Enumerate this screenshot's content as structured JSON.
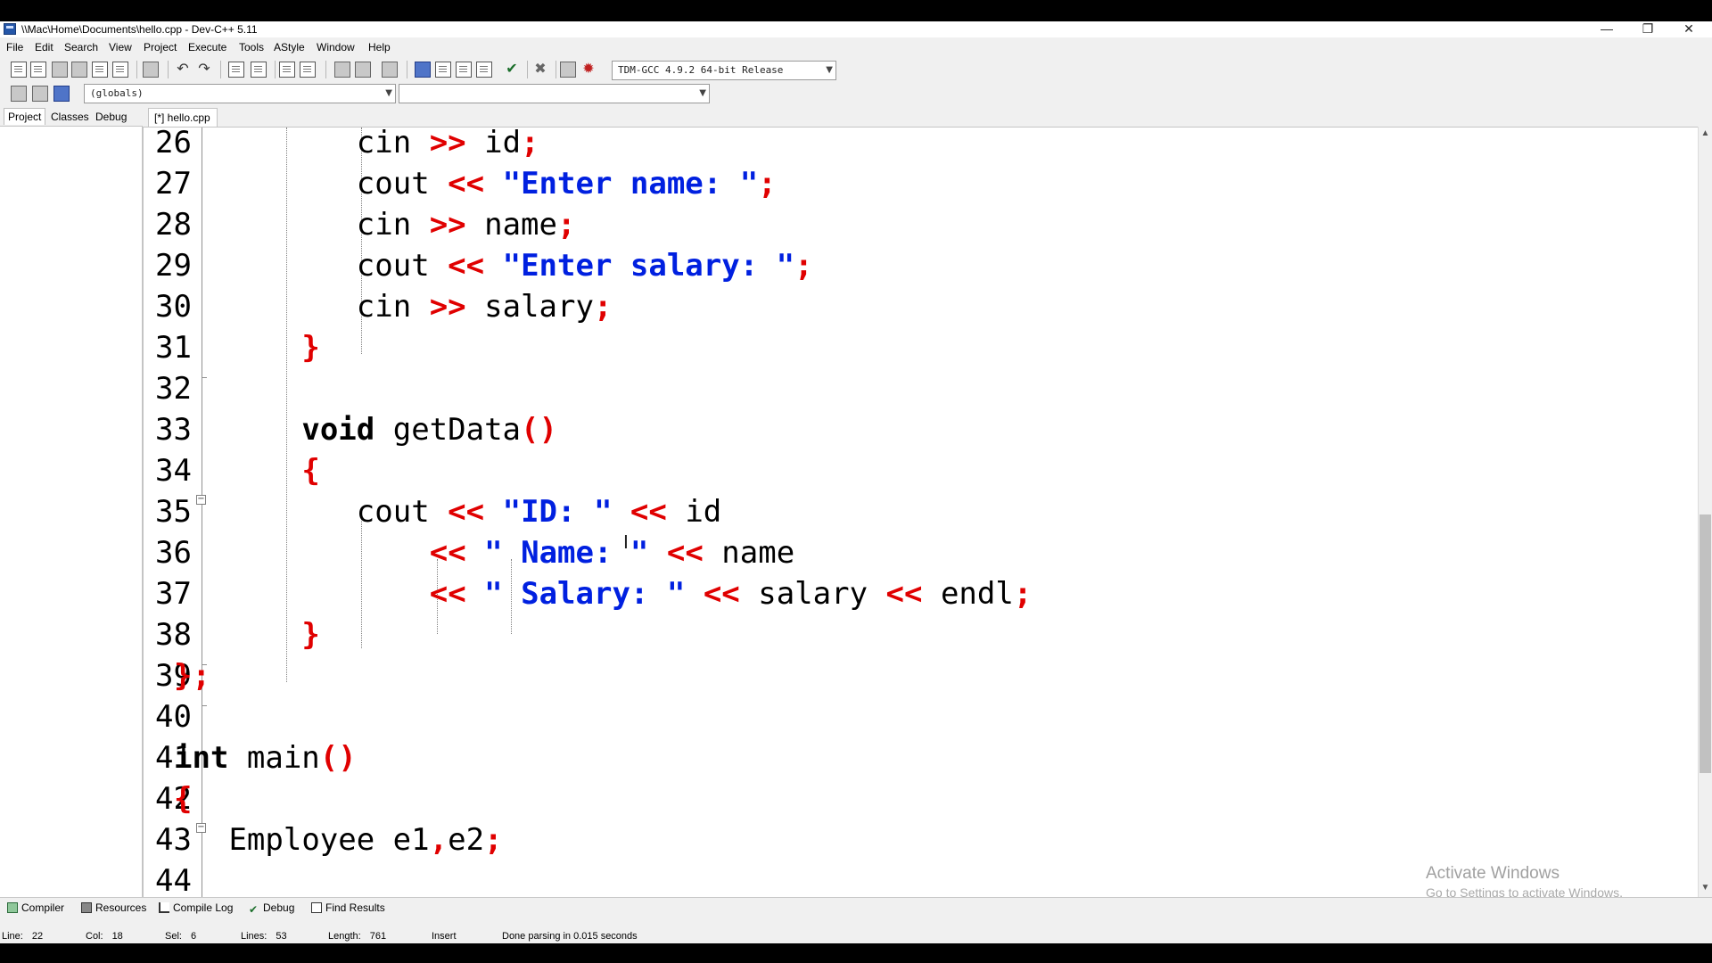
{
  "window": {
    "title": "\\\\Mac\\Home\\Documents\\hello.cpp - Dev-C++ 5.11",
    "minimize_glyph": "—",
    "restore_glyph": "❐",
    "close_glyph": "✕"
  },
  "menu": [
    "File",
    "Edit",
    "Search",
    "View",
    "Project",
    "Execute",
    "Tools",
    "AStyle",
    "Window",
    "Help"
  ],
  "toolbar": {
    "compiler_select": "TDM-GCC 4.9.2 64-bit Release",
    "scope_select": "(globals)",
    "member_select": ""
  },
  "left_panel": {
    "tabs": [
      "Project",
      "Classes",
      "Debug"
    ]
  },
  "editor": {
    "tab_label": "[*] hello.cpp",
    "line_numbers": [
      "26",
      "27",
      "28",
      "29",
      "30",
      "31",
      "32",
      "33",
      "34",
      "35",
      "36",
      "37",
      "38",
      "39",
      "40",
      "41",
      "42",
      "43",
      "44"
    ],
    "lines": [
      [
        [
          "id",
          "cin "
        ],
        [
          "op",
          ">>"
        ],
        [
          "id",
          " id"
        ],
        [
          "op",
          ";"
        ]
      ],
      [
        [
          "id",
          "cout "
        ],
        [
          "op",
          "<<"
        ],
        [
          "id",
          " "
        ],
        [
          "str",
          "\"Enter name: \""
        ],
        [
          "op",
          ";"
        ]
      ],
      [
        [
          "id",
          "cin "
        ],
        [
          "op",
          ">>"
        ],
        [
          "id",
          " name"
        ],
        [
          "op",
          ";"
        ]
      ],
      [
        [
          "id",
          "cout "
        ],
        [
          "op",
          "<<"
        ],
        [
          "id",
          " "
        ],
        [
          "str",
          "\"Enter salary: \""
        ],
        [
          "op",
          ";"
        ]
      ],
      [
        [
          "id",
          "cin "
        ],
        [
          "op",
          ">>"
        ],
        [
          "id",
          " salary"
        ],
        [
          "op",
          ";"
        ]
      ],
      [
        [
          "op",
          "}"
        ]
      ],
      [],
      [
        [
          "kw",
          "void"
        ],
        [
          "id",
          " getData"
        ],
        [
          "op",
          "()"
        ]
      ],
      [
        [
          "op",
          "{"
        ]
      ],
      [
        [
          "id",
          "cout "
        ],
        [
          "op",
          "<<"
        ],
        [
          "id",
          " "
        ],
        [
          "str",
          "\"ID: \""
        ],
        [
          "id",
          " "
        ],
        [
          "op",
          "<<"
        ],
        [
          "id",
          " id"
        ]
      ],
      [
        [
          "op",
          "<<"
        ],
        [
          "id",
          " "
        ],
        [
          "str",
          "\" Name: \""
        ],
        [
          "id",
          " "
        ],
        [
          "op",
          "<<"
        ],
        [
          "id",
          " name"
        ]
      ],
      [
        [
          "op",
          "<<"
        ],
        [
          "id",
          " "
        ],
        [
          "str",
          "\" Salary: \""
        ],
        [
          "id",
          " "
        ],
        [
          "op",
          "<<"
        ],
        [
          "id",
          " salary "
        ],
        [
          "op",
          "<<"
        ],
        [
          "id",
          " endl"
        ],
        [
          "op",
          ";"
        ]
      ],
      [
        [
          "op",
          "}"
        ]
      ],
      [
        [
          "op",
          "};"
        ]
      ],
      [],
      [
        [
          "kw",
          "int"
        ],
        [
          "id",
          " main"
        ],
        [
          "op",
          "()"
        ]
      ],
      [
        [
          "op",
          "{"
        ]
      ],
      [
        [
          "id",
          "Employee e1"
        ],
        [
          "op",
          ","
        ],
        [
          "id",
          "e2"
        ],
        [
          "op",
          ";"
        ]
      ],
      []
    ],
    "scroll_up_glyph": "▲",
    "scroll_down_glyph": "▼"
  },
  "watermark": {
    "title": "Activate Windows",
    "subtitle": "Go to Settings to activate Windows."
  },
  "bottom_tabs": [
    "Compiler",
    "Resources",
    "Compile Log",
    "Debug",
    "Find Results"
  ],
  "status": {
    "line_label": "Line:",
    "line_value": "22",
    "col_label": "Col:",
    "col_value": "18",
    "sel_label": "Sel:",
    "sel_value": "6",
    "lines_label": "Lines:",
    "lines_value": "53",
    "length_label": "Length:",
    "length_value": "761",
    "mode": "Insert",
    "message": "Done parsing in 0.015 seconds"
  },
  "icons": [
    "new-file-icon",
    "open-icon",
    "save-icon",
    "save-all-icon",
    "close-file-icon",
    "close-all-icon",
    "print-icon",
    "undo-icon",
    "redo-icon",
    "find-icon",
    "replace-icon",
    "goto-line-icon",
    "indent-icon",
    "unindent-icon",
    "toggle-comment-icon",
    "compile-icon",
    "run-icon",
    "compile-run-icon",
    "rebuild-icon",
    "syntax-check-icon",
    "stop-icon",
    "profile-icon",
    "debug-icon"
  ]
}
